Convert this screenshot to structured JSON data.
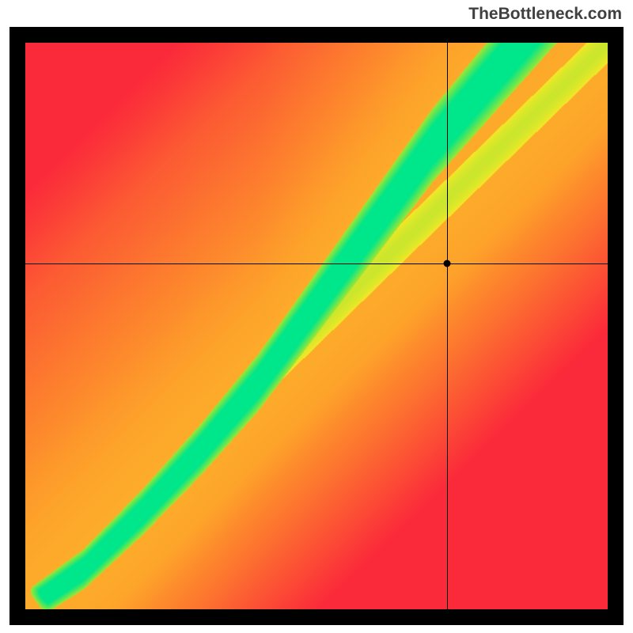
{
  "watermark": "TheBottleneck.com",
  "chart_data": {
    "type": "heatmap",
    "title": "",
    "xlabel": "",
    "ylabel": "",
    "xlim": [
      0,
      1
    ],
    "ylim": [
      0,
      1
    ],
    "marker": {
      "x": 0.725,
      "y": 0.61
    },
    "crosshair": {
      "x": 0.725,
      "y": 0.61
    },
    "optimal_path": {
      "description": "green ridge of best match; value is closeness to ideal",
      "points": [
        {
          "x": 0.0,
          "y": 0.0
        },
        {
          "x": 0.1,
          "y": 0.07
        },
        {
          "x": 0.2,
          "y": 0.17
        },
        {
          "x": 0.3,
          "y": 0.28
        },
        {
          "x": 0.4,
          "y": 0.4
        },
        {
          "x": 0.5,
          "y": 0.54
        },
        {
          "x": 0.6,
          "y": 0.68
        },
        {
          "x": 0.7,
          "y": 0.82
        },
        {
          "x": 0.8,
          "y": 0.94
        },
        {
          "x": 0.85,
          "y": 1.0
        }
      ]
    },
    "secondary_band": {
      "description": "faint yellow-green band along y≈x diagonal",
      "points": [
        {
          "x": 0.0,
          "y": 0.0
        },
        {
          "x": 1.0,
          "y": 1.0
        }
      ]
    },
    "color_scale": {
      "low": "#fb2a3a",
      "mid_low": "#fd8b2c",
      "mid": "#fde725",
      "mid_high": "#a0e632",
      "high": "#00e68a"
    }
  },
  "colors": {
    "frame": "#000000",
    "page_bg": "#ffffff"
  }
}
